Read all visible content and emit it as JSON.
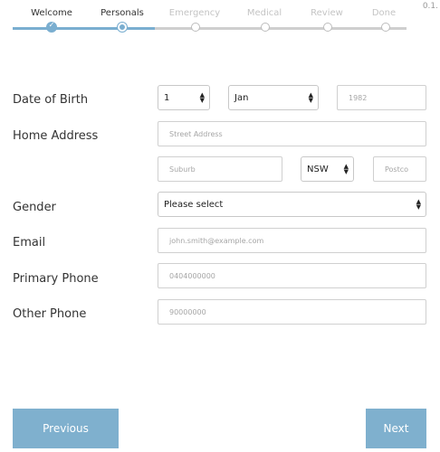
{
  "version": "0.1.",
  "stepper": {
    "steps": [
      "Welcome",
      "Personals",
      "Emergency",
      "Medical",
      "Review",
      "Done"
    ]
  },
  "form": {
    "dob": {
      "label": "Date of Birth",
      "day": "1",
      "month": "Jan",
      "year_placeholder": "1982"
    },
    "address": {
      "label": "Home Address",
      "street_placeholder": "Street Address",
      "suburb_placeholder": "Suburb",
      "state": "NSW",
      "postcode_placeholder": "Postco"
    },
    "gender": {
      "label": "Gender",
      "value": "Please select"
    },
    "email": {
      "label": "Email",
      "placeholder": "john.smith@example.com"
    },
    "primary_phone": {
      "label": "Primary Phone",
      "placeholder": "0404000000"
    },
    "other_phone": {
      "label": "Other Phone",
      "placeholder": "90000000"
    }
  },
  "footer": {
    "previous_label": "Previous",
    "next_label": "Next"
  },
  "colors": {
    "accent": "#7fb0ce"
  }
}
